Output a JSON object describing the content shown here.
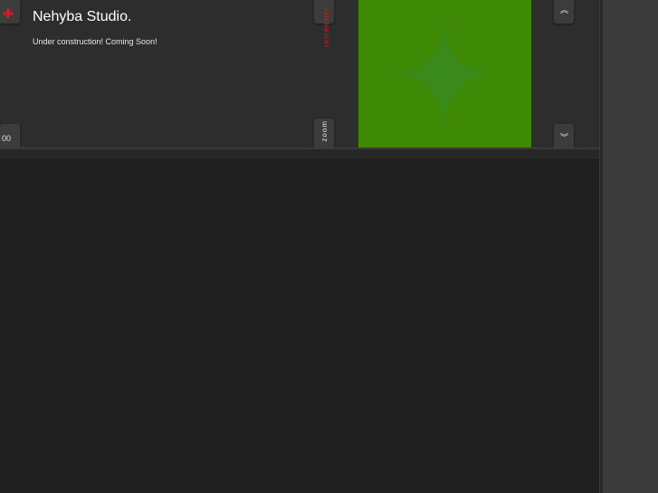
{
  "site": {
    "title": "Nehyba Studio.",
    "tagline": "Under construction! Coming Soon!"
  },
  "tabs": {
    "add_icon": "plus-icon",
    "counter": "00",
    "remember_label": "remember",
    "zoom_label": "zoom",
    "scroll_up_icon": "double-chevron-up-icon",
    "scroll_down_icon": "double-chevron-down-icon"
  },
  "colors": {
    "accent_red": "#cc1f1f",
    "green_panel": "#3e8a06",
    "panel_bg": "#2d2d2d",
    "page_bg": "#202020"
  }
}
